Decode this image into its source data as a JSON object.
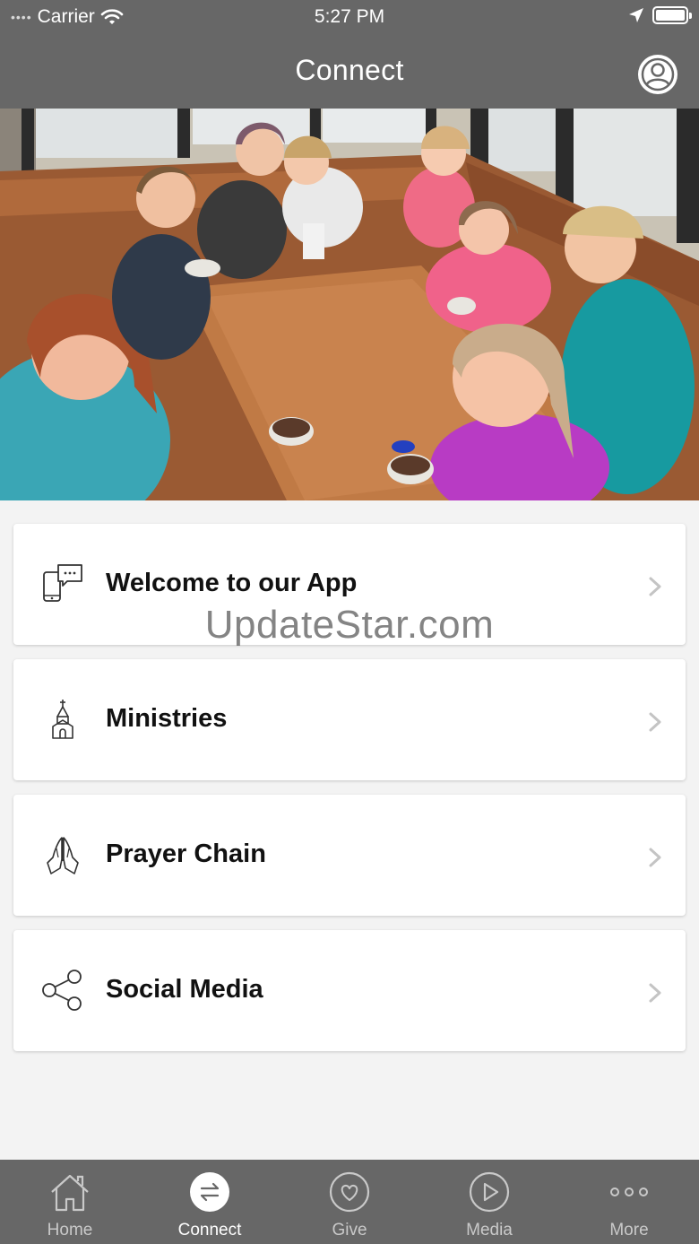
{
  "status_bar": {
    "signal_dots": "••••",
    "carrier": "Carrier",
    "time": "5:27 PM"
  },
  "nav": {
    "title": "Connect"
  },
  "cards": [
    {
      "label": "Welcome to our App",
      "icon": "phone-chat-icon"
    },
    {
      "label": "Ministries",
      "icon": "church-icon"
    },
    {
      "label": "Prayer Chain",
      "icon": "praying-hands-icon"
    },
    {
      "label": "Social Media",
      "icon": "share-icon"
    }
  ],
  "watermark": "UpdateStar.com",
  "tabs": [
    {
      "label": "Home",
      "icon": "home-icon",
      "active": false
    },
    {
      "label": "Connect",
      "icon": "connect-arrows-icon",
      "active": true
    },
    {
      "label": "Give",
      "icon": "heart-icon",
      "active": false
    },
    {
      "label": "Media",
      "icon": "play-icon",
      "active": false
    },
    {
      "label": "More",
      "icon": "more-dots-icon",
      "active": false
    }
  ],
  "colors": {
    "bar_background": "#676767",
    "page_background": "#f3f3f3",
    "card_background": "#ffffff",
    "tab_inactive": "#c9c9c9",
    "tab_active": "#ffffff"
  }
}
